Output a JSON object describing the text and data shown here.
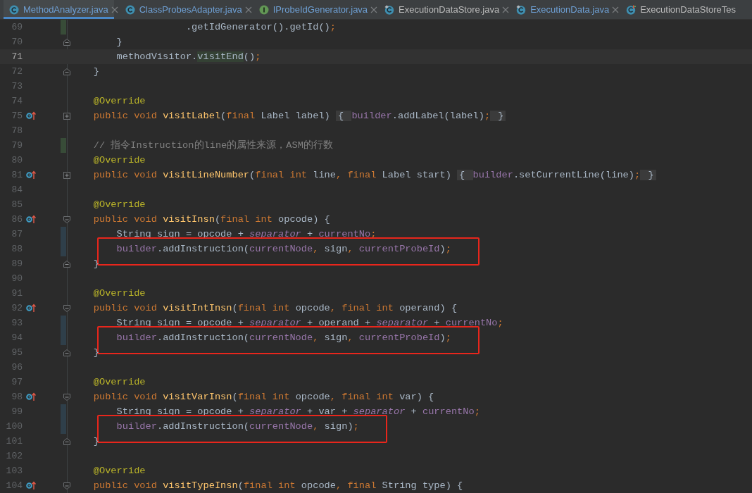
{
  "tabs": [
    {
      "label": "MethodAnalyzer.java",
      "kind": "class",
      "modified": true,
      "selected": true,
      "closable": true
    },
    {
      "label": "ClassProbesAdapter.java",
      "kind": "class",
      "modified": true,
      "selected": false,
      "closable": true
    },
    {
      "label": "IProbeIdGenerator.java",
      "kind": "interface",
      "modified": true,
      "selected": false,
      "closable": true
    },
    {
      "label": "ExecutionDataStore.java",
      "kind": "library",
      "modified": false,
      "selected": false,
      "closable": true
    },
    {
      "label": "ExecutionData.java",
      "kind": "library",
      "modified": true,
      "selected": false,
      "closable": true
    },
    {
      "label": "ExecutionDataStoreTes",
      "kind": "test",
      "modified": false,
      "selected": false,
      "closable": false
    }
  ],
  "editor": {
    "lines": [
      {
        "number": "69",
        "current": false,
        "boxed": false,
        "marks": [
          {
            "kind": "added"
          }
        ],
        "tokens": [
          {
            "text": "                    .getIdGenerator().getId()",
            "kind": "plain"
          },
          {
            "text": ";",
            "kind": "punct"
          }
        ]
      },
      {
        "number": "70",
        "current": false,
        "boxed": false,
        "marks": [
          {
            "kind": "fold_end"
          }
        ],
        "tokens": [
          {
            "text": "        }",
            "kind": "plain"
          }
        ]
      },
      {
        "number": "71",
        "current": true,
        "boxed": false,
        "tokens": [
          {
            "text": "        methodVisitor.",
            "kind": "plain"
          },
          {
            "text": "visitEnd",
            "kind": "usage"
          },
          {
            "text": "()",
            "kind": "plain"
          },
          {
            "text": ";",
            "kind": "punct"
          }
        ]
      },
      {
        "number": "72",
        "current": false,
        "boxed": false,
        "marks": [
          {
            "kind": "fold_end"
          }
        ],
        "tokens": [
          {
            "text": "    }",
            "kind": "plain"
          }
        ]
      },
      {
        "number": "73",
        "current": false,
        "boxed": false
      },
      {
        "number": "74",
        "current": false,
        "boxed": false,
        "tokens": [
          {
            "text": "    @Override",
            "kind": "annotation"
          }
        ]
      },
      {
        "number": "75",
        "current": false,
        "boxed": false,
        "marks": [
          {
            "kind": "override"
          },
          {
            "kind": "collapsed"
          }
        ],
        "tokens": [
          {
            "text": "    public void ",
            "kind": "keyword"
          },
          {
            "text": "visitLabel",
            "kind": "declaration"
          },
          {
            "text": "(",
            "kind": "plain"
          },
          {
            "text": "final ",
            "kind": "keyword"
          },
          {
            "text": "Label label) ",
            "kind": "plain"
          },
          {
            "text": "{ ",
            "kind": "folded"
          },
          {
            "text": "builder",
            "kind": "field"
          },
          {
            "text": ".addLabel(label)",
            "kind": "plain"
          },
          {
            "text": ";",
            "kind": "punct"
          },
          {
            "text": " }",
            "kind": "folded"
          }
        ]
      },
      {
        "number": "78",
        "current": false,
        "boxed": false
      },
      {
        "number": "79",
        "current": false,
        "boxed": false,
        "marks": [
          {
            "kind": "added"
          }
        ],
        "tokens": [
          {
            "text": "    // 指令Instruction的line的属性来源，ASM的行数",
            "kind": "comment"
          }
        ]
      },
      {
        "number": "80",
        "current": false,
        "boxed": false,
        "tokens": [
          {
            "text": "    @Override",
            "kind": "annotation"
          }
        ]
      },
      {
        "number": "81",
        "current": false,
        "boxed": false,
        "marks": [
          {
            "kind": "override"
          },
          {
            "kind": "collapsed"
          }
        ],
        "tokens": [
          {
            "text": "    public void ",
            "kind": "keyword"
          },
          {
            "text": "visitLineNumber",
            "kind": "declaration"
          },
          {
            "text": "(",
            "kind": "plain"
          },
          {
            "text": "final int ",
            "kind": "keyword"
          },
          {
            "text": "line",
            "kind": "plain"
          },
          {
            "text": ", ",
            "kind": "punct"
          },
          {
            "text": "final ",
            "kind": "keyword"
          },
          {
            "text": "Label start) ",
            "kind": "plain"
          },
          {
            "text": "{ ",
            "kind": "folded"
          },
          {
            "text": "builder",
            "kind": "field"
          },
          {
            "text": ".setCurrentLine(line)",
            "kind": "plain"
          },
          {
            "text": ";",
            "kind": "punct"
          },
          {
            "text": " }",
            "kind": "folded"
          }
        ]
      },
      {
        "number": "84",
        "current": false,
        "boxed": false
      },
      {
        "number": "85",
        "current": false,
        "boxed": false,
        "tokens": [
          {
            "text": "    @Override",
            "kind": "annotation"
          }
        ]
      },
      {
        "number": "86",
        "current": false,
        "boxed": false,
        "marks": [
          {
            "kind": "override"
          },
          {
            "kind": "fold_start"
          }
        ],
        "tokens": [
          {
            "text": "    public void ",
            "kind": "keyword"
          },
          {
            "text": "visitInsn",
            "kind": "declaration"
          },
          {
            "text": "(",
            "kind": "plain"
          },
          {
            "text": "final int ",
            "kind": "keyword"
          },
          {
            "text": "opcode) {",
            "kind": "plain"
          }
        ]
      },
      {
        "number": "87",
        "current": false,
        "boxed": false,
        "marks": [
          {
            "kind": "modified"
          }
        ],
        "tokens": [
          {
            "text": "        String sign = opcode + ",
            "kind": "plain"
          },
          {
            "text": "separator",
            "kind": "static"
          },
          {
            "text": " + ",
            "kind": "plain"
          },
          {
            "text": "currentNo",
            "kind": "field"
          },
          {
            "text": ";",
            "kind": "punct"
          }
        ]
      },
      {
        "number": "88",
        "current": false,
        "boxed": true,
        "marks": [
          {
            "kind": "modified"
          }
        ],
        "tokens": [
          {
            "text": "        builder",
            "kind": "field"
          },
          {
            "text": ".addInstruction(",
            "kind": "plain"
          },
          {
            "text": "currentNode",
            "kind": "field"
          },
          {
            "text": ", ",
            "kind": "punct"
          },
          {
            "text": "sign",
            "kind": "plain"
          },
          {
            "text": ", ",
            "kind": "punct"
          },
          {
            "text": "currentProbeId",
            "kind": "field"
          },
          {
            "text": ")",
            "kind": "plain"
          },
          {
            "text": ";",
            "kind": "punct"
          }
        ]
      },
      {
        "number": "89",
        "current": false,
        "boxed": false,
        "marks": [
          {
            "kind": "fold_end"
          }
        ],
        "tokens": [
          {
            "text": "    }",
            "kind": "plain"
          }
        ]
      },
      {
        "number": "90",
        "current": false,
        "boxed": false
      },
      {
        "number": "91",
        "current": false,
        "boxed": false,
        "tokens": [
          {
            "text": "    @Override",
            "kind": "annotation"
          }
        ]
      },
      {
        "number": "92",
        "current": false,
        "boxed": false,
        "marks": [
          {
            "kind": "override"
          },
          {
            "kind": "fold_start"
          }
        ],
        "tokens": [
          {
            "text": "    public void ",
            "kind": "keyword"
          },
          {
            "text": "visitIntInsn",
            "kind": "declaration"
          },
          {
            "text": "(",
            "kind": "plain"
          },
          {
            "text": "final int ",
            "kind": "keyword"
          },
          {
            "text": "opcode",
            "kind": "plain"
          },
          {
            "text": ", ",
            "kind": "punct"
          },
          {
            "text": "final int ",
            "kind": "keyword"
          },
          {
            "text": "operand) {",
            "kind": "plain"
          }
        ]
      },
      {
        "number": "93",
        "current": false,
        "boxed": false,
        "marks": [
          {
            "kind": "modified"
          }
        ],
        "tokens": [
          {
            "text": "        String sign = opcode + ",
            "kind": "plain"
          },
          {
            "text": "separator",
            "kind": "static"
          },
          {
            "text": " + operand + ",
            "kind": "plain"
          },
          {
            "text": "separator",
            "kind": "static"
          },
          {
            "text": " + ",
            "kind": "plain"
          },
          {
            "text": "currentNo",
            "kind": "field"
          },
          {
            "text": ";",
            "kind": "punct"
          }
        ]
      },
      {
        "number": "94",
        "current": false,
        "boxed": true,
        "marks": [
          {
            "kind": "modified"
          }
        ],
        "tokens": [
          {
            "text": "        builder",
            "kind": "field"
          },
          {
            "text": ".addInstruction(",
            "kind": "plain"
          },
          {
            "text": "currentNode",
            "kind": "field"
          },
          {
            "text": ", ",
            "kind": "punct"
          },
          {
            "text": "sign",
            "kind": "plain"
          },
          {
            "text": ", ",
            "kind": "punct"
          },
          {
            "text": "currentProbeId",
            "kind": "field"
          },
          {
            "text": ")",
            "kind": "plain"
          },
          {
            "text": ";",
            "kind": "punct"
          }
        ]
      },
      {
        "number": "95",
        "current": false,
        "boxed": false,
        "marks": [
          {
            "kind": "fold_end"
          }
        ],
        "tokens": [
          {
            "text": "    }",
            "kind": "plain"
          }
        ]
      },
      {
        "number": "96",
        "current": false,
        "boxed": false
      },
      {
        "number": "97",
        "current": false,
        "boxed": false,
        "tokens": [
          {
            "text": "    @Override",
            "kind": "annotation"
          }
        ]
      },
      {
        "number": "98",
        "current": false,
        "boxed": false,
        "marks": [
          {
            "kind": "override"
          },
          {
            "kind": "fold_start"
          }
        ],
        "tokens": [
          {
            "text": "    public void ",
            "kind": "keyword"
          },
          {
            "text": "visitVarInsn",
            "kind": "declaration"
          },
          {
            "text": "(",
            "kind": "plain"
          },
          {
            "text": "final int ",
            "kind": "keyword"
          },
          {
            "text": "opcode",
            "kind": "plain"
          },
          {
            "text": ", ",
            "kind": "punct"
          },
          {
            "text": "final int ",
            "kind": "keyword"
          },
          {
            "text": "var) {",
            "kind": "plain"
          }
        ]
      },
      {
        "number": "99",
        "current": false,
        "boxed": false,
        "marks": [
          {
            "kind": "modified"
          }
        ],
        "tokens": [
          {
            "text": "        String sign = opcode + ",
            "kind": "plain"
          },
          {
            "text": "separator",
            "kind": "static"
          },
          {
            "text": " + var + ",
            "kind": "plain"
          },
          {
            "text": "separator",
            "kind": "static"
          },
          {
            "text": " + ",
            "kind": "plain"
          },
          {
            "text": "currentNo",
            "kind": "field"
          },
          {
            "text": ";",
            "kind": "punct"
          }
        ]
      },
      {
        "number": "100",
        "current": false,
        "boxed": true,
        "marks": [
          {
            "kind": "modified"
          }
        ],
        "tokens": [
          {
            "text": "        builder",
            "kind": "field"
          },
          {
            "text": ".addInstruction(",
            "kind": "plain"
          },
          {
            "text": "currentNode",
            "kind": "field"
          },
          {
            "text": ", ",
            "kind": "punct"
          },
          {
            "text": "sign",
            "kind": "plain"
          },
          {
            "text": ")",
            "kind": "plain"
          },
          {
            "text": ";",
            "kind": "punct"
          }
        ]
      },
      {
        "number": "101",
        "current": false,
        "boxed": false,
        "marks": [
          {
            "kind": "fold_end"
          }
        ],
        "tokens": [
          {
            "text": "    }",
            "kind": "plain"
          }
        ]
      },
      {
        "number": "102",
        "current": false,
        "boxed": false
      },
      {
        "number": "103",
        "current": false,
        "boxed": false,
        "tokens": [
          {
            "text": "    @Override",
            "kind": "annotation"
          }
        ]
      },
      {
        "number": "104",
        "current": false,
        "boxed": false,
        "marks": [
          {
            "kind": "override"
          },
          {
            "kind": "fold_start"
          }
        ],
        "tokens": [
          {
            "text": "    public void ",
            "kind": "keyword"
          },
          {
            "text": "visitTypeInsn",
            "kind": "declaration"
          },
          {
            "text": "(",
            "kind": "plain"
          },
          {
            "text": "final int ",
            "kind": "keyword"
          },
          {
            "text": "opcode",
            "kind": "plain"
          },
          {
            "text": ", ",
            "kind": "punct"
          },
          {
            "text": "final ",
            "kind": "keyword"
          },
          {
            "text": "String type) {",
            "kind": "plain"
          }
        ]
      }
    ]
  }
}
